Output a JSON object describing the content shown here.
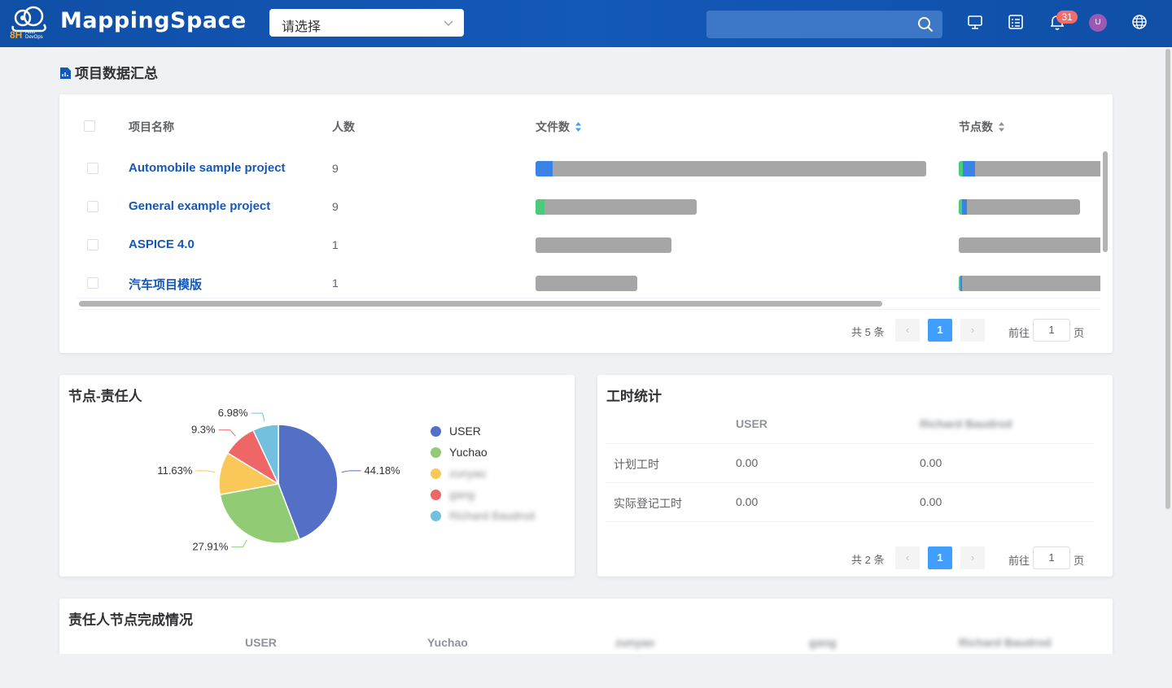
{
  "header": {
    "logo_text": "8H",
    "logo_subtext": "Auto DevOps",
    "brand": "MappingSpace",
    "project_select": {
      "value": "请选择"
    },
    "search": {
      "placeholder": ""
    },
    "notification_count": "31",
    "avatar_initial": "U",
    "icons": [
      "monitor-icon",
      "task-list-icon",
      "bell-icon",
      "globe-icon"
    ]
  },
  "summary": {
    "title": "项目数据汇总",
    "columns": {
      "name": "项目名称",
      "people": "人数",
      "files": "文件数",
      "nodes": "节点数"
    },
    "rows": [
      {
        "name": "Automobile sample project",
        "people": "9"
      },
      {
        "name": "General example project",
        "people": "9"
      },
      {
        "name": "ASPICE 4.0",
        "people": "1"
      },
      {
        "name": "汽车项目模版",
        "people": "1"
      }
    ],
    "pager": {
      "total": "共 5 条",
      "current": "1",
      "goto_label": "前往",
      "goto_value": "1",
      "page_suffix": "页",
      "prev": "‹",
      "next": "›"
    }
  },
  "node_owner": {
    "title": "节点-责任人",
    "chart_data": {
      "type": "pie",
      "title": "节点-责任人",
      "slices": [
        {
          "name": "USER",
          "value": 44.18,
          "label": "44.18%",
          "color": "#5470c6"
        },
        {
          "name": "Yuchao",
          "value": 27.91,
          "label": "27.91%",
          "color": "#91cc75"
        },
        {
          "name": "zunyao",
          "value": 11.63,
          "label": "11.63%",
          "color": "#fac858"
        },
        {
          "name": "gang",
          "value": 9.3,
          "label": "9.3%",
          "color": "#ee6666"
        },
        {
          "name": "Richard Baudrod",
          "value": 6.98,
          "label": "6.98%",
          "color": "#73c0de"
        }
      ],
      "legend_position": "right"
    }
  },
  "work_hours": {
    "title": "工时统计",
    "columns": [
      "USER",
      "Richard Baudrod"
    ],
    "rows": [
      {
        "label": "计划工时",
        "values": [
          "0.00",
          "0.00"
        ]
      },
      {
        "label": "实际登记工时",
        "values": [
          "0.00",
          "0.00"
        ]
      }
    ],
    "pager": {
      "total": "共 2 条",
      "current": "1",
      "goto_label": "前往",
      "goto_value": "1",
      "page_suffix": "页",
      "prev": "‹",
      "next": "›"
    }
  },
  "completion": {
    "title": "责任人节点完成情况",
    "columns": [
      "USER",
      "Yuchao",
      "zunyao",
      "gang",
      "Richard Baudrod"
    ]
  }
}
